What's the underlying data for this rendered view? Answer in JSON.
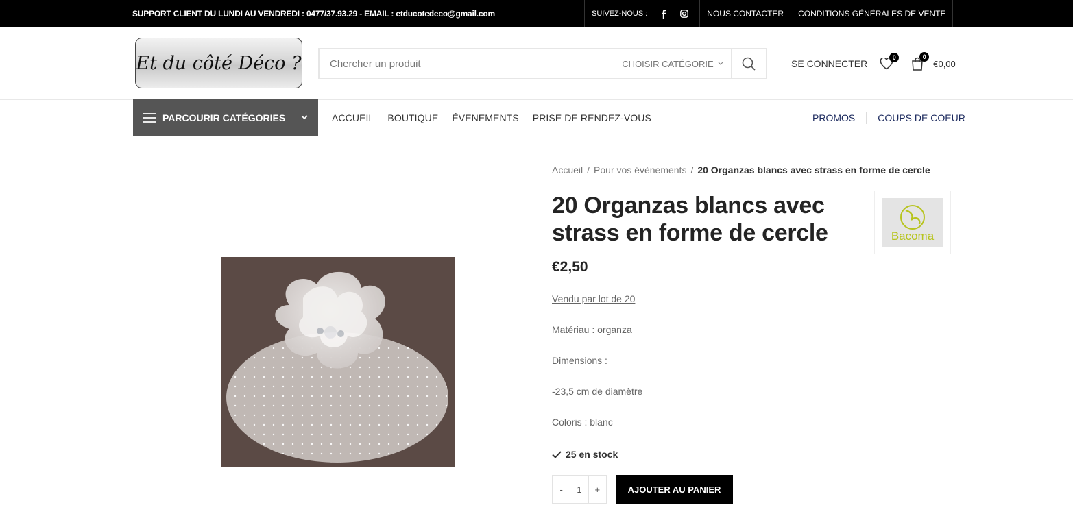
{
  "topbar": {
    "support": "SUPPORT CLIENT DU LUNDI AU VENDREDI : 0477/37.93.29 - EMAIL : etducotedeco@gmail.com",
    "follow_label": "SUIVEZ-NOUS :",
    "contact": "NOUS CONTACTER",
    "cgv": "CONDITIONS GÉNÉRALES DE VENTE",
    "social_icons": [
      "facebook-icon",
      "instagram-icon"
    ]
  },
  "header": {
    "logo_text": "Et du côté Déco ?",
    "search_placeholder": "Chercher un produit",
    "category_select": "CHOISIR CATÉGORIE",
    "login": "SE CONNECTER",
    "wishlist_count": "0",
    "cart_count": "0",
    "cart_total": "€0,00"
  },
  "nav": {
    "browse": "PARCOURIR CATÉGORIES",
    "items": [
      "ACCUEIL",
      "BOUTIQUE",
      "ÉVENEMENTS",
      "PRISE DE RENDEZ-VOUS"
    ],
    "right": [
      "PROMOS",
      "COUPS DE COEUR"
    ]
  },
  "breadcrumb": {
    "home": "Accueil",
    "sep": "/",
    "category": "Pour vos évènements",
    "current": "20 Organzas blancs avec strass en forme de cercle"
  },
  "product": {
    "title": "20 Organzas blancs avec strass en forme de cercle",
    "brand": "Bacoma",
    "price": "€2,50",
    "lot": "Vendu par lot de 20",
    "material": "Matériau : organza",
    "dimensions": "Dimensions :",
    "diameter": "-23,5 cm de diamètre",
    "color": "Coloris : blanc",
    "stock": "25 en stock",
    "qty_minus": "-",
    "qty_value": "1",
    "qty_plus": "+",
    "add_to_cart": "AJOUTER AU PANIER"
  },
  "colors": {
    "topbar_bg": "#000000",
    "browse_bg": "#555555",
    "nav_right": "#1c2a5e",
    "brand_green": "#b7c41e"
  }
}
